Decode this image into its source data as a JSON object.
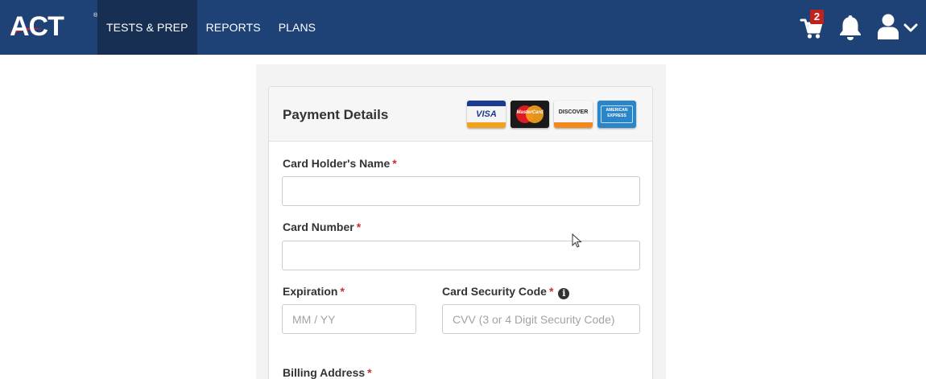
{
  "brand": {
    "logo_text": "ACT",
    "trademark": "®"
  },
  "nav": {
    "items": [
      {
        "label": "TESTS & PREP",
        "active": true
      },
      {
        "label": "REPORTS",
        "active": false
      },
      {
        "label": "PLANS",
        "active": false
      }
    ]
  },
  "header_icons": {
    "cart_icon": "cart-icon",
    "cart_count": "2",
    "bell_icon": "bell-icon",
    "user_icon": "user-icon",
    "chevron_icon": "chevron-down-icon"
  },
  "colors": {
    "topbar": "#1e4276",
    "active_nav": "#172f52",
    "badge": "#c0221d",
    "required": "#c9302c"
  },
  "payment": {
    "title": "Payment Details",
    "accepted_cards": [
      "VISA",
      "MasterCard",
      "DISCOVER",
      "AMERICAN EXPRESS"
    ],
    "fields": {
      "card_holder_name": {
        "label": "Card Holder's Name",
        "required_mark": "*",
        "value": "",
        "placeholder": ""
      },
      "card_number": {
        "label": "Card Number",
        "required_mark": "*",
        "value": "",
        "placeholder": ""
      },
      "expiration": {
        "label": "Expiration",
        "required_mark": "*",
        "value": "",
        "placeholder": "MM / YY"
      },
      "security_code": {
        "label": "Card Security Code",
        "required_mark": "*",
        "value": "",
        "placeholder": "CVV (3 or 4 Digit Security Code)",
        "info_icon": "i"
      },
      "billing_address": {
        "label": "Billing Address",
        "required_mark": "*"
      }
    }
  }
}
